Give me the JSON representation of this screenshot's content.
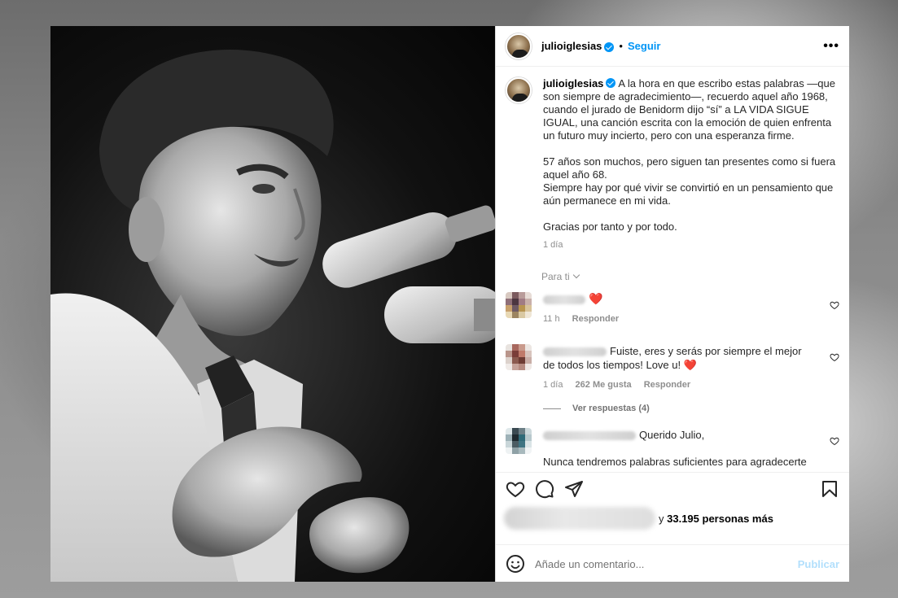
{
  "post": {
    "username": "julioiglesias",
    "follow_label": "Seguir",
    "separator": "•",
    "more_label": "•••",
    "caption_paragraphs": [
      "A la hora en que escribo estas palabras —que son siempre de agradecimiento—, recuerdo aquel año 1968, cuando el jurado de Benidorm dijo “sí” a LA VIDA SIGUE IGUAL, una canción escrita con la emoción de quien enfrenta un futuro muy incierto, pero con una esperanza firme.",
      "57 años son muchos, pero siguen tan presentes como si fuera aquel año 68.\nSiempre hay por qué vivir se convirtió en un pensamiento que aún permanece en mi vida.",
      "Gracias por tanto y por todo."
    ],
    "caption_time": "1 día",
    "sort_label": "Para ti"
  },
  "comments": [
    {
      "text": "❤️",
      "time": "11 h",
      "reply_label": "Responder",
      "likes": ""
    },
    {
      "text": "Fuiste, eres y serás por siempre el mejor de todos los tiempos! Love u! ❤️",
      "time": "1 día",
      "likes": "262 Me gusta",
      "reply_label": "Responder",
      "view_replies": "Ver respuestas (4)"
    },
    {
      "text_line1": "Querido Julio,",
      "text_line2": "Nunca tendremos palabras suficientes para agradecerte tanto trabajo, tanta buena música y tantas lecciones de vida. Tu obra"
    }
  ],
  "actions": {
    "likes_suffix": "y",
    "likes_count": "33.195 personas más",
    "comment_placeholder": "Añade un comentario...",
    "publish_label": "Publicar"
  },
  "colors": {
    "accent": "#0095f6",
    "heart": "#ed4956",
    "publish_disabled": "#b2dffc"
  },
  "icons": [
    "more-icon",
    "verified-icon",
    "heart-icon",
    "comment-icon",
    "share-icon",
    "save-icon",
    "emoji-icon",
    "chevron-down-icon"
  ]
}
